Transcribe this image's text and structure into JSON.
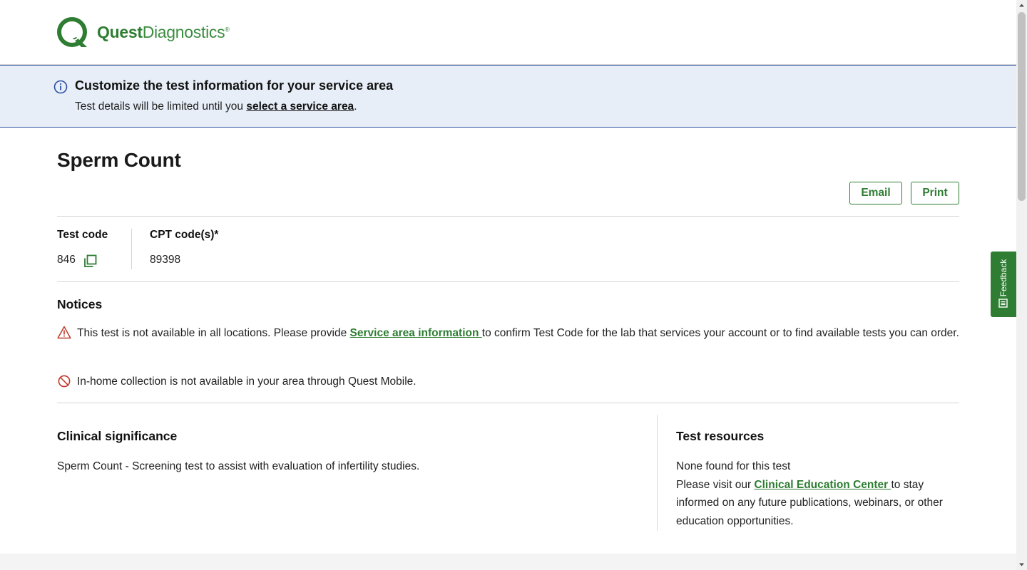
{
  "brand": {
    "logo_name_bold": "Quest",
    "logo_name_regular": "Diagnostics",
    "logo_mark": "®",
    "brand_color": "#2e7d32"
  },
  "banner": {
    "icon": "info-icon",
    "title": "Customize the test information for your service area",
    "text_prefix": "Test details will be limited until you ",
    "link": "select a service area",
    "text_suffix": ".",
    "background": "#e7eef8"
  },
  "test": {
    "title": "Sperm Count",
    "actions": {
      "email": "Email",
      "print": "Print"
    },
    "test_code_label": "Test code",
    "test_code": "846",
    "cpt_label": "CPT code(s)*",
    "cpt_code": "89398"
  },
  "notices": {
    "title": "Notices",
    "items": [
      {
        "icon": "warning-icon",
        "prefix": "This test is not available in all locations. Please provide ",
        "link": "Service area information ",
        "suffix": "to confirm Test Code for the lab that services your account or to find available tests you can order."
      },
      {
        "icon": "ban-icon",
        "text": "In-home collection is not available in your area through Quest Mobile."
      }
    ]
  },
  "clinical": {
    "title": "Clinical significance",
    "text": "Sperm Count - Screening test to assist with evaluation of infertility studies."
  },
  "resources": {
    "title": "Test resources",
    "none_found": "None found for this test",
    "prefix": "Please visit our ",
    "link": "Clinical Education Center ",
    "suffix": "to stay informed on any future publications, webinars, or other education opportunities."
  },
  "feedback": {
    "label": "Feedback",
    "icon": "feedback-icon"
  }
}
